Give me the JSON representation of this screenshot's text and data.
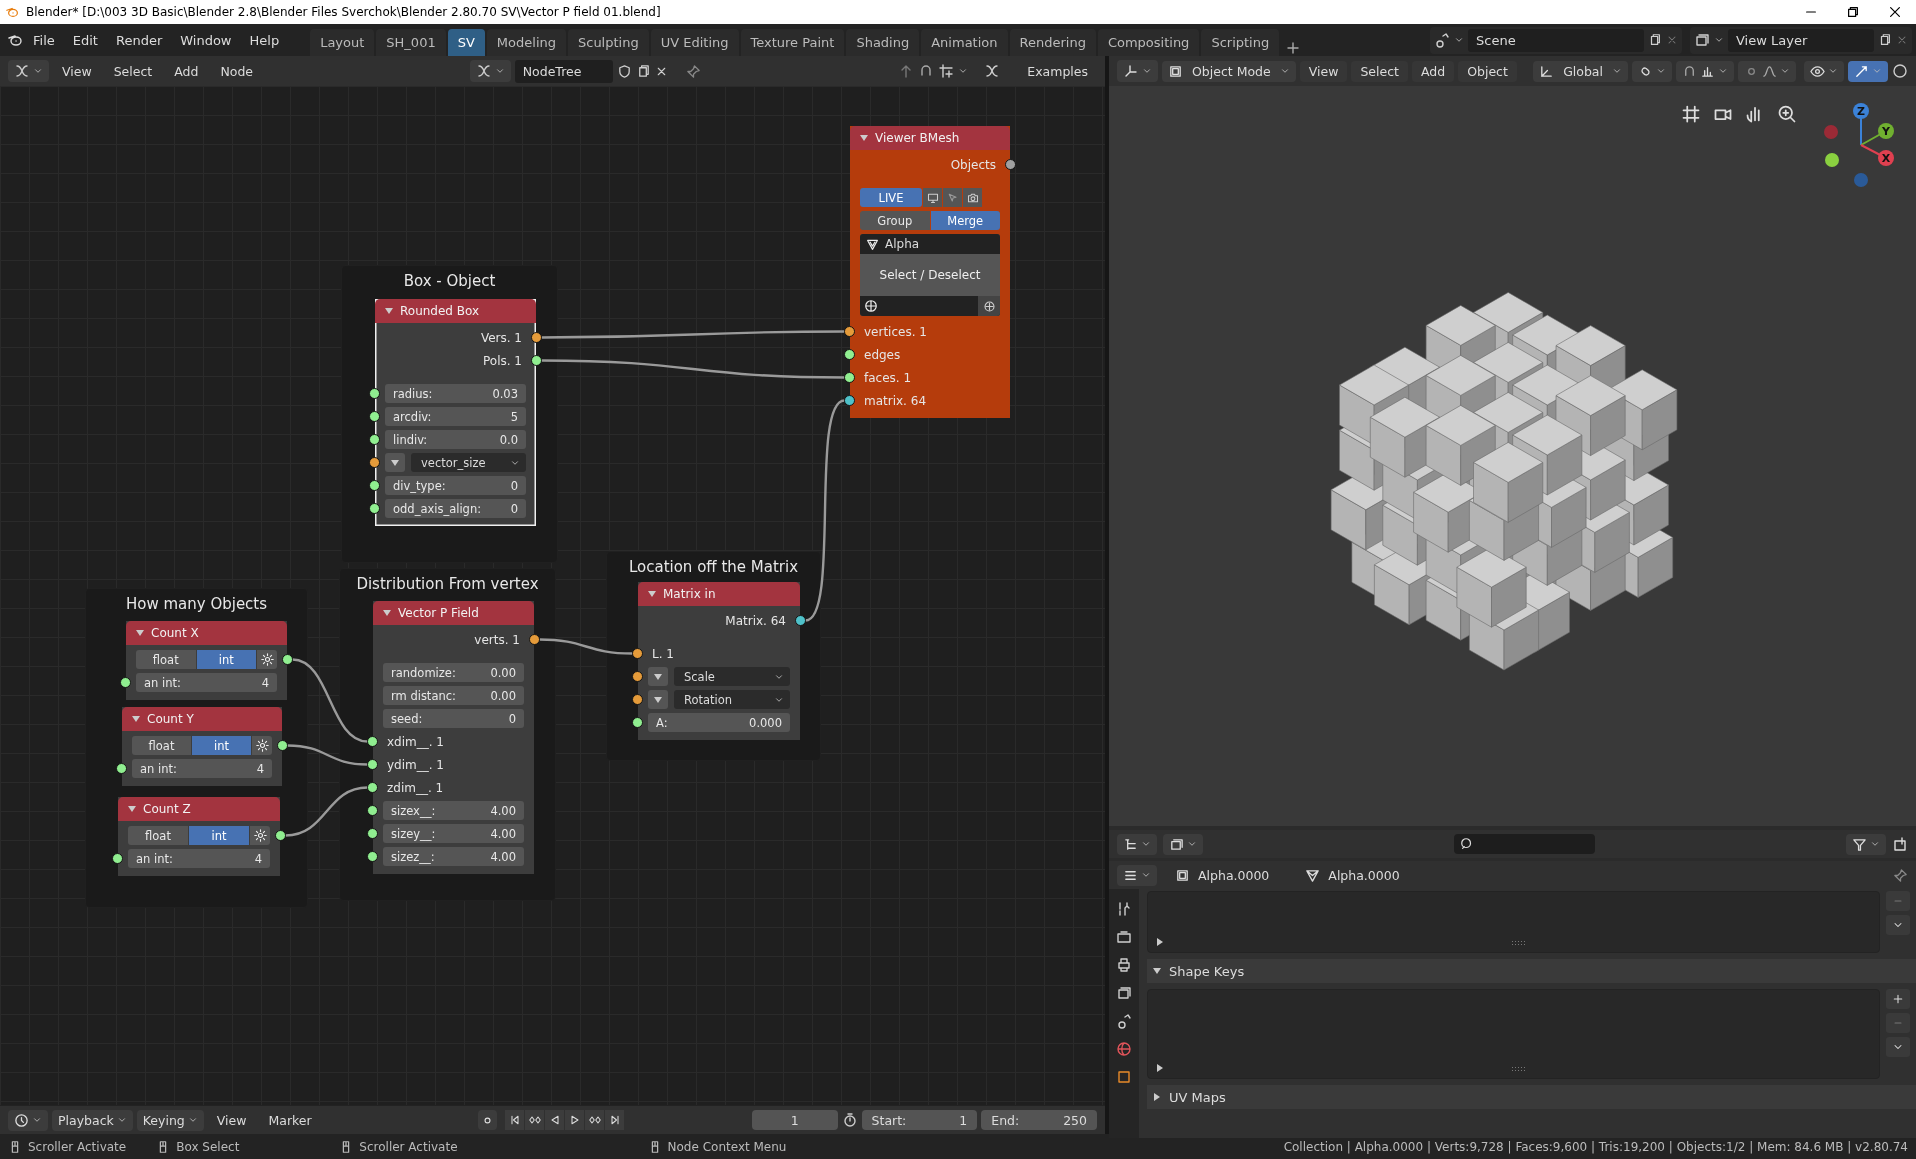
{
  "window": {
    "title": "Blender* [D:\\003 3D Basic\\Blender 2.8\\Blender Files Sverchok\\Blender 2.80.70 SV\\Vector P field 01.blend]"
  },
  "menu": [
    "File",
    "Edit",
    "Render",
    "Window",
    "Help"
  ],
  "workspaces": [
    {
      "label": "Layout",
      "selected": false
    },
    {
      "label": "SH_001",
      "selected": false
    },
    {
      "label": "SV",
      "selected": true
    },
    {
      "label": "Modeling",
      "selected": false
    },
    {
      "label": "Sculpting",
      "selected": false
    },
    {
      "label": "UV Editing",
      "selected": false
    },
    {
      "label": "Texture Paint",
      "selected": false
    },
    {
      "label": "Shading",
      "selected": false
    },
    {
      "label": "Animation",
      "selected": false
    },
    {
      "label": "Rendering",
      "selected": false
    },
    {
      "label": "Compositing",
      "selected": false
    },
    {
      "label": "Scripting",
      "selected": false
    }
  ],
  "scene": "Scene",
  "view_layer": "View Layer",
  "node_editor": {
    "menus": [
      "View",
      "Select",
      "Add",
      "Node"
    ],
    "node_tree": "NodeTree",
    "examples": "Examples",
    "frames": [
      {
        "title": "Box - Object"
      },
      {
        "title": "How many Objects"
      },
      {
        "title": "Distribution From vertex"
      },
      {
        "title": "Location off the Matrix"
      }
    ],
    "nodes": [
      {
        "title": "Viewer BMesh",
        "selected": false,
        "color": "#b53c0c",
        "items": [
          {
            "kind": "output",
            "label": "Objects",
            "color": "#a0a0a0"
          },
          {
            "kind": "live",
            "label": "LIVE",
            "on": true
          },
          {
            "kind": "switch",
            "options": [
              {
                "label": "Group",
                "selected": false
              },
              {
                "label": "Merge",
                "selected": true
              }
            ]
          },
          {
            "kind": "object_panel",
            "name": "Alpha",
            "button": "Select / Deselect"
          },
          {
            "kind": "input",
            "label": "vertices. 1",
            "color": "#e59b3a"
          },
          {
            "kind": "input",
            "label": "edges",
            "color": "#90ee90"
          },
          {
            "kind": "input",
            "label": "faces. 1",
            "color": "#90ee90"
          },
          {
            "kind": "input",
            "label": "matrix. 64",
            "color": "#4fc1c9"
          }
        ]
      },
      {
        "title": "Rounded Box",
        "selected": true,
        "items": [
          {
            "kind": "output",
            "label": "Vers. 1",
            "color": "#e59b3a"
          },
          {
            "kind": "output",
            "label": "Pols. 1",
            "color": "#90ee90"
          },
          {
            "kind": "field",
            "label": "radius:",
            "value": "0.03",
            "color": "#90ee90"
          },
          {
            "kind": "field",
            "label": "arcdiv:",
            "value": "5",
            "color": "#90ee90"
          },
          {
            "kind": "field",
            "label": "lindiv:",
            "value": "0.0",
            "color": "#90ee90"
          },
          {
            "kind": "dropdown",
            "value": "vector_size",
            "color": "#e59b3a"
          },
          {
            "kind": "field",
            "label": "div_type:",
            "value": "0",
            "color": "#90ee90"
          },
          {
            "kind": "field",
            "label": "odd_axis_align:",
            "value": "0",
            "color": "#90ee90"
          }
        ]
      },
      {
        "title": "Count X",
        "selected": false,
        "items": [
          {
            "kind": "switch",
            "gear": true,
            "color": "#90ee90",
            "options": [
              {
                "label": "float",
                "selected": false
              },
              {
                "label": "int",
                "selected": true
              }
            ]
          },
          {
            "kind": "field",
            "label": "an int:",
            "value": "4",
            "color": "#90ee90"
          }
        ]
      },
      {
        "title": "Count Y",
        "selected": false,
        "items": [
          {
            "kind": "switch",
            "gear": true,
            "color": "#90ee90",
            "options": [
              {
                "label": "float",
                "selected": false
              },
              {
                "label": "int",
                "selected": true
              }
            ]
          },
          {
            "kind": "field",
            "label": "an int:",
            "value": "4",
            "color": "#90ee90"
          }
        ]
      },
      {
        "title": "Count Z",
        "selected": false,
        "items": [
          {
            "kind": "switch",
            "gear": true,
            "color": "#90ee90",
            "options": [
              {
                "label": "float",
                "selected": false
              },
              {
                "label": "int",
                "selected": true
              }
            ]
          },
          {
            "kind": "field",
            "label": "an int:",
            "value": "4",
            "color": "#90ee90"
          }
        ]
      },
      {
        "title": "Vector P Field",
        "selected": false,
        "items": [
          {
            "kind": "output",
            "label": "verts. 1",
            "color": "#e59b3a"
          },
          {
            "kind": "field",
            "label": "randomize:",
            "value": "0.00"
          },
          {
            "kind": "field",
            "label": "rm distanc:",
            "value": "0.00"
          },
          {
            "kind": "field",
            "label": "seed:",
            "value": "0"
          },
          {
            "kind": "input",
            "label": "xdim__. 1",
            "color": "#90ee90"
          },
          {
            "kind": "input",
            "label": "ydim__. 1",
            "color": "#90ee90"
          },
          {
            "kind": "input",
            "label": "zdim__. 1",
            "color": "#90ee90"
          },
          {
            "kind": "field",
            "label": "sizex__:",
            "value": "4.00",
            "color": "#90ee90"
          },
          {
            "kind": "field",
            "label": "sizey__:",
            "value": "4.00",
            "color": "#90ee90"
          },
          {
            "kind": "field",
            "label": "sizez__:",
            "value": "4.00",
            "color": "#90ee90"
          }
        ]
      },
      {
        "title": "Matrix in",
        "selected": false,
        "items": [
          {
            "kind": "output",
            "label": "Matrix. 64",
            "color": "#4fc1c9"
          },
          {
            "kind": "input",
            "label": "L. 1",
            "color": "#e59b3a"
          },
          {
            "kind": "dropdown",
            "value": "Scale",
            "color": "#e59b3a"
          },
          {
            "kind": "dropdown",
            "value": "Rotation",
            "color": "#e59b3a"
          },
          {
            "kind": "field",
            "label": "A:",
            "value": "0.000",
            "color": "#90ee90"
          }
        ]
      }
    ]
  },
  "viewport": {
    "mode": "Object Mode",
    "menus": [
      "View",
      "Select",
      "Add",
      "Object"
    ],
    "orientation": "Global",
    "gizmo": [
      "X",
      "Y",
      "Z"
    ]
  },
  "properties": {
    "object": "Alpha.0000",
    "mesh": "Alpha.0000",
    "panels": [
      {
        "title": "Shape Keys",
        "expanded": true
      },
      {
        "title": "UV Maps",
        "expanded": false
      }
    ]
  },
  "timeline": {
    "menus": [
      {
        "label": "Playback",
        "dropdown": true
      },
      {
        "label": "Keying",
        "dropdown": true
      },
      {
        "label": "View",
        "dropdown": false
      },
      {
        "label": "Marker",
        "dropdown": false
      }
    ],
    "frame": "1",
    "start_label": "Start:",
    "start": "1",
    "end_label": "End:",
    "end": "250"
  },
  "status_bar": {
    "hints": [
      "Scroller Activate",
      "Box Select",
      "Scroller Activate",
      "Node Context Menu"
    ],
    "stats": "Collection | Alpha.0000 | Verts:9,728 | Faces:9,600 | Tris:19,200 | Objects:1/2 | Mem: 84.6 MB | v2.80.74"
  }
}
